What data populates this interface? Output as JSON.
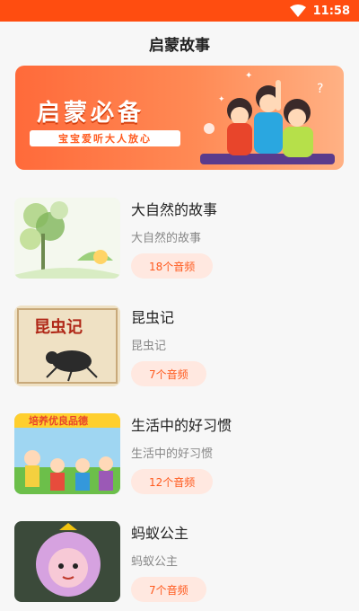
{
  "status_bar": {
    "time": "11:58",
    "icon": "wifi-icon"
  },
  "header": {
    "title": "启蒙故事"
  },
  "banner": {
    "headline": "启蒙必备",
    "slogan": "宝宝爱听大人放心"
  },
  "stories": [
    {
      "title": "大自然的故事",
      "subtitle": "大自然的故事",
      "count": "18个音频",
      "thumb": "nature-illustration"
    },
    {
      "title": "昆虫记",
      "subtitle": "昆虫记",
      "count": "7个音频",
      "thumb": "insect-book-cover",
      "thumb_text": "昆虫记"
    },
    {
      "title": "生活中的好习惯",
      "subtitle": "生活中的好习惯",
      "count": "12个音频",
      "thumb": "good-habits-cartoon",
      "thumb_text": "培养优良品德"
    },
    {
      "title": "蚂蚁公主",
      "subtitle": "蚂蚁公主",
      "count": "7个音频",
      "thumb": "ant-princess-cartoon"
    }
  ],
  "colors": {
    "accent": "#ff4d10",
    "badge_bg": "#ffe8e0",
    "badge_text": "#ff5a1e"
  }
}
